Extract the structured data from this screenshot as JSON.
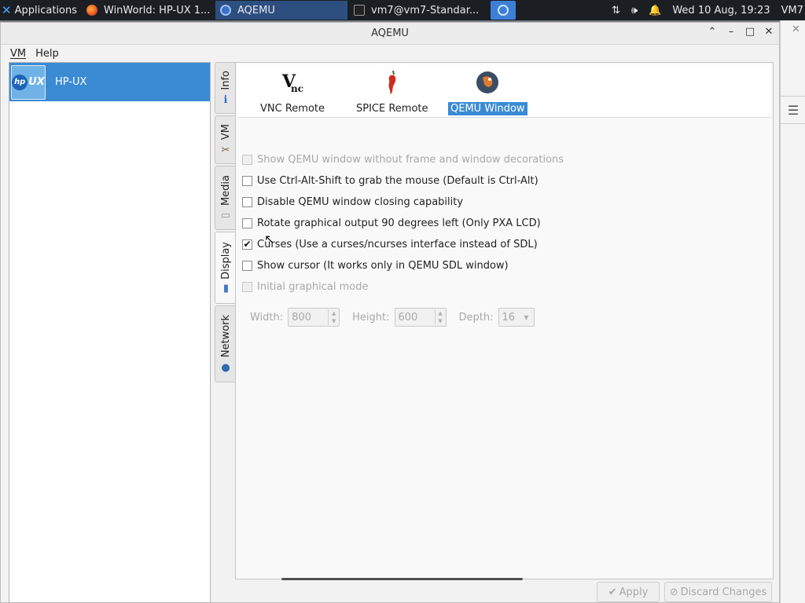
{
  "taskbar": {
    "applications_label": "Applications",
    "tasks": [
      {
        "label": "WinWorld: HP-UX 1...",
        "icon": "firefox-icon",
        "active": false
      },
      {
        "label": "AQEMU",
        "icon": "aqemu-icon",
        "active": true
      },
      {
        "label": "vm7@vm7-Standar...",
        "icon": "terminal-icon",
        "active": false
      }
    ],
    "clock": "Wed 10 Aug, 19:23",
    "user": "VM7"
  },
  "window": {
    "title": "AQEMU"
  },
  "menubar": {
    "vm_label": "VM",
    "help_label": "Help"
  },
  "vm_list": [
    {
      "name": "HP-UX",
      "logo_text": "UX",
      "logo_brand": "hp"
    }
  ],
  "vertical_tabs": [
    {
      "label": "Info",
      "icon": "info-icon"
    },
    {
      "label": "VM",
      "icon": "tools-icon"
    },
    {
      "label": "Media",
      "icon": "media-icon"
    },
    {
      "label": "Display",
      "icon": "display-icon",
      "active": true
    },
    {
      "label": "Network",
      "icon": "network-icon"
    }
  ],
  "display_modes": [
    {
      "label": "VNC Remote",
      "icon": "vnc-icon"
    },
    {
      "label": "SPICE Remote",
      "icon": "spice-icon"
    },
    {
      "label": "QEMU Window",
      "icon": "qemu-icon",
      "selected": true
    }
  ],
  "options": [
    {
      "label": "Show QEMU window without frame and window decorations",
      "checked": false,
      "disabled": true
    },
    {
      "label": "Use Ctrl-Alt-Shift to grab the mouse (Default is Ctrl-Alt)",
      "checked": false,
      "disabled": false
    },
    {
      "label": "Disable QEMU window closing capability",
      "checked": false,
      "disabled": false
    },
    {
      "label": "Rotate graphical output 90 degrees left (Only PXA LCD)",
      "checked": false,
      "disabled": false
    },
    {
      "label": "Curses (Use a curses/ncurses interface instead of SDL)",
      "checked": true,
      "disabled": false
    },
    {
      "label": "Show cursor (It works only in QEMU SDL window)",
      "checked": false,
      "disabled": false
    },
    {
      "label": "Initial graphical mode",
      "checked": false,
      "disabled": true
    }
  ],
  "resolution": {
    "width_label": "Width:",
    "width_value": "800",
    "height_label": "Height:",
    "height_value": "600",
    "depth_label": "Depth:",
    "depth_value": "16"
  },
  "buttons": {
    "apply_label": "Apply",
    "discard_label": "Discard Changes"
  },
  "colors": {
    "selection": "#3b8bd4",
    "taskbar_bg": "#1b1f24"
  }
}
